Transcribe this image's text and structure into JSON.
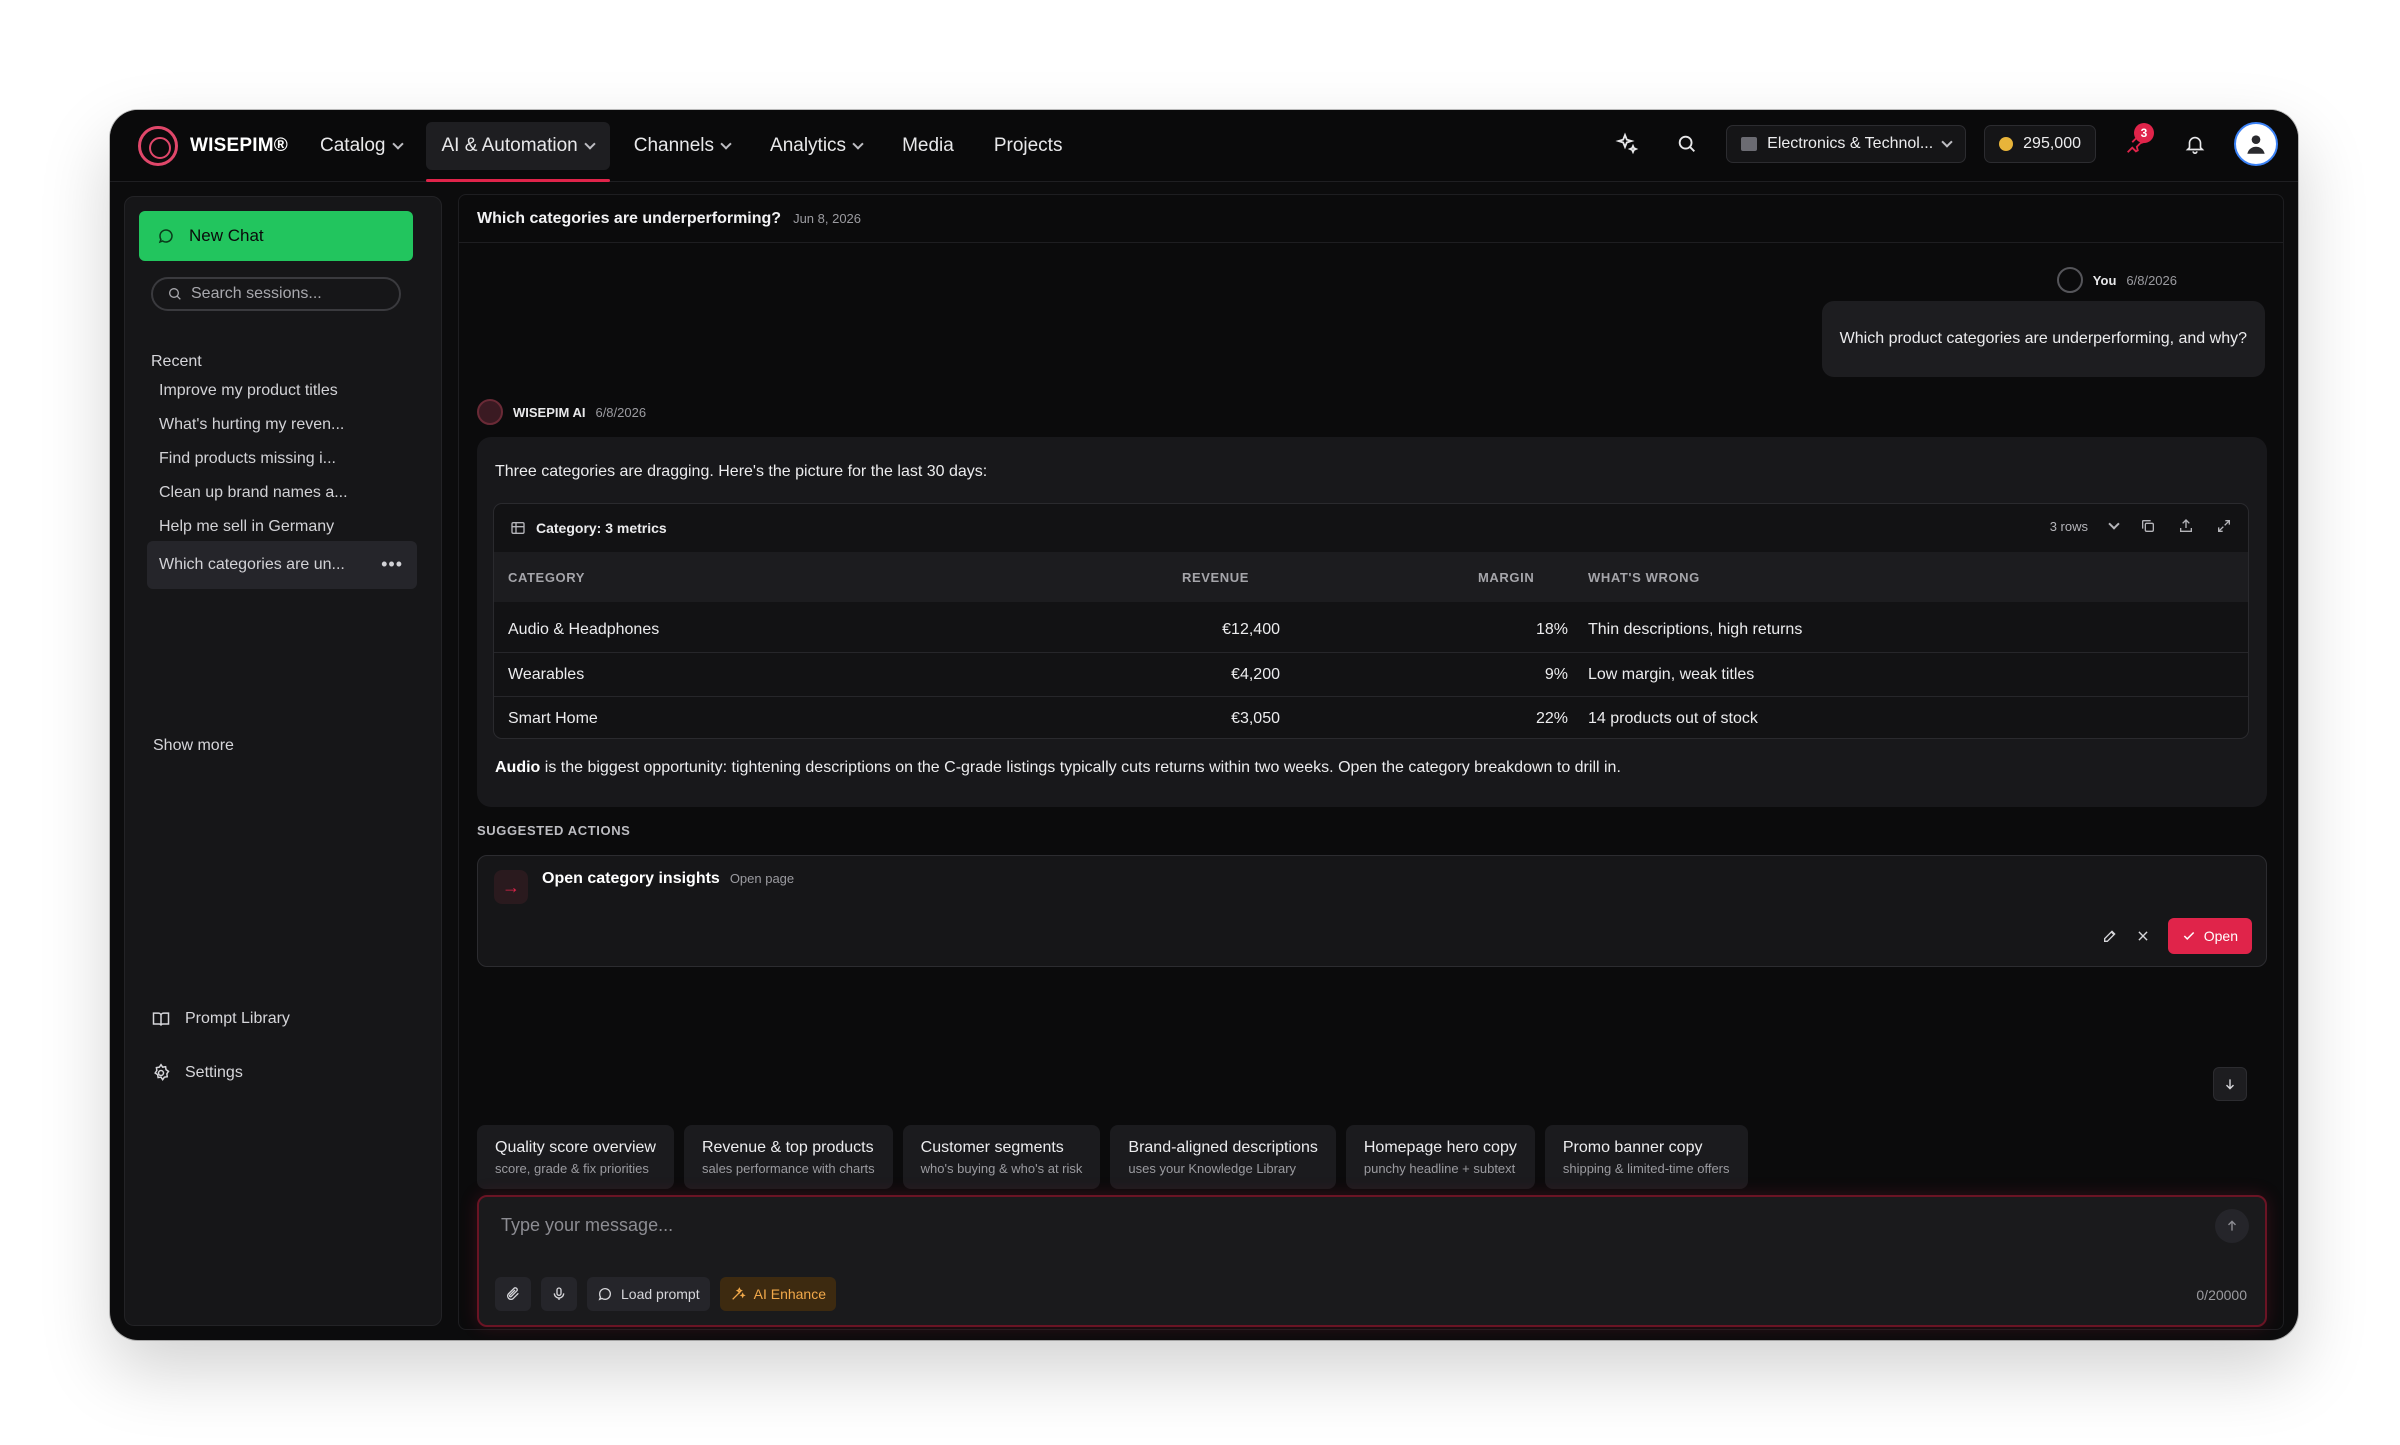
{
  "brand": {
    "name": "WISEPIM®"
  },
  "nav": {
    "items": [
      {
        "label": "Catalog",
        "dropdown": true,
        "active": false
      },
      {
        "label": "AI & Automation",
        "dropdown": true,
        "active": true
      },
      {
        "label": "Channels",
        "dropdown": true,
        "active": false
      },
      {
        "label": "Analytics",
        "dropdown": true,
        "active": false
      },
      {
        "label": "Media",
        "dropdown": false,
        "active": false
      },
      {
        "label": "Projects",
        "dropdown": false,
        "active": false
      }
    ]
  },
  "topbar": {
    "store": "Electronics & Technol...",
    "credits": "295,000",
    "notif_count": "3"
  },
  "sidebar": {
    "new_chat": "New Chat",
    "search_placeholder": "Search sessions...",
    "recent_label": "Recent",
    "sessions": [
      "Improve my product titles",
      "What's hurting my reven...",
      "Find products missing i...",
      "Clean up brand names a...",
      "Help me sell in Germany",
      "Which categories are un..."
    ],
    "more_icon": "•••",
    "show_more": "Show more",
    "prompt_library": "Prompt Library",
    "settings": "Settings"
  },
  "chat": {
    "title": "Which categories are underperforming?",
    "date": "Jun 8, 2026",
    "user": {
      "name": "You",
      "date": "6/8/2026",
      "message": "Which product categories are underperforming, and why?"
    },
    "ai": {
      "name": "WISEPIM AI",
      "date": "6/8/2026",
      "intro": "Three categories are dragging. Here's the picture for the last 30 days:",
      "table": {
        "title": "Category: 3 metrics",
        "row_count": "3 rows",
        "headers": [
          "CATEGORY",
          "REVENUE",
          "MARGIN",
          "WHAT'S WRONG"
        ],
        "rows": [
          [
            "Audio & Headphones",
            "€12,400",
            "18%",
            "Thin descriptions, high returns"
          ],
          [
            "Wearables",
            "€4,200",
            "9%",
            "Low margin, weak titles"
          ],
          [
            "Smart Home",
            "€3,050",
            "22%",
            "14 products out of stock"
          ]
        ]
      },
      "summary_bold": "Audio",
      "summary_rest": " is the biggest opportunity: tightening descriptions on the C-grade listings typically cuts returns within two weeks. Open the category breakdown to drill in."
    },
    "suggested": {
      "label": "SUGGESTED ACTIONS",
      "title": "Open category insights",
      "sub": "Open page",
      "open_label": "Open"
    },
    "chips": [
      {
        "title": "Quality score overview",
        "sub": "score, grade & fix priorities"
      },
      {
        "title": "Revenue & top products",
        "sub": "sales performance with charts"
      },
      {
        "title": "Customer segments",
        "sub": "who's buying & who's at risk"
      },
      {
        "title": "Brand-aligned descriptions",
        "sub": "uses your Knowledge Library"
      },
      {
        "title": "Homepage hero copy",
        "sub": "punchy headline + subtext"
      },
      {
        "title": "Promo banner copy",
        "sub": "shipping & limited-time offers"
      }
    ],
    "composer": {
      "placeholder": "Type your message...",
      "load_prompt": "Load prompt",
      "ai_enhance": "AI Enhance",
      "char_count": "0/20000"
    }
  },
  "colors": {
    "accent": "#e0244a",
    "new_chat": "#22c55e",
    "enhance": "#f2a94a"
  }
}
